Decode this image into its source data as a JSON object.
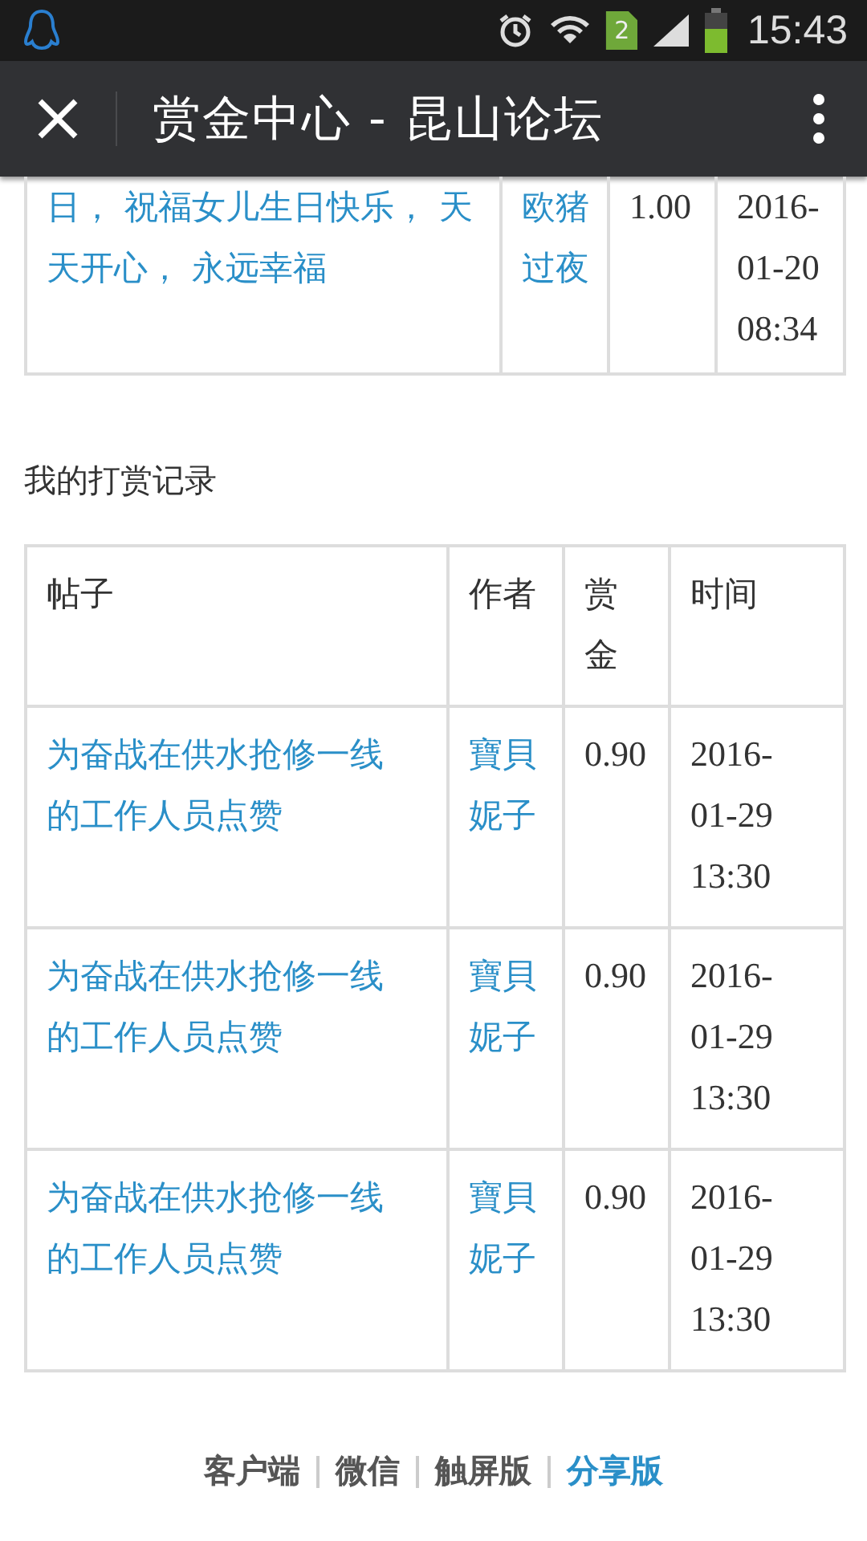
{
  "status_bar": {
    "sim_badge": "2",
    "time": "15:43"
  },
  "app_bar": {
    "title": "赏金中心 - 昆山论坛"
  },
  "received_table": {
    "rows": [
      {
        "post": "日， 祝福女儿生日快乐， 天天开心， 永远幸福",
        "author": "欧猪过夜",
        "amount": "1.00",
        "time": "2016-01-20 08:34"
      }
    ]
  },
  "section_title": "我的打赏记录",
  "given_table": {
    "columns": [
      "帖子",
      "作者",
      "赏金",
      "时间"
    ],
    "rows": [
      {
        "post": "为奋战在供水抢修一线的工作人员点赞",
        "author": "寶貝妮子",
        "amount": "0.90",
        "time": "2016-01-29 13:30"
      },
      {
        "post": "为奋战在供水抢修一线的工作人员点赞",
        "author": "寶貝妮子",
        "amount": "0.90",
        "time": "2016-01-29 13:30"
      },
      {
        "post": "为奋战在供水抢修一线的工作人员点赞",
        "author": "寶貝妮子",
        "amount": "0.90",
        "time": "2016-01-29 13:30"
      }
    ]
  },
  "footer_links": [
    {
      "label": "客户端",
      "selected": false
    },
    {
      "label": "微信",
      "selected": false
    },
    {
      "label": "触屏版",
      "selected": false
    },
    {
      "label": "分享版",
      "selected": true
    }
  ]
}
